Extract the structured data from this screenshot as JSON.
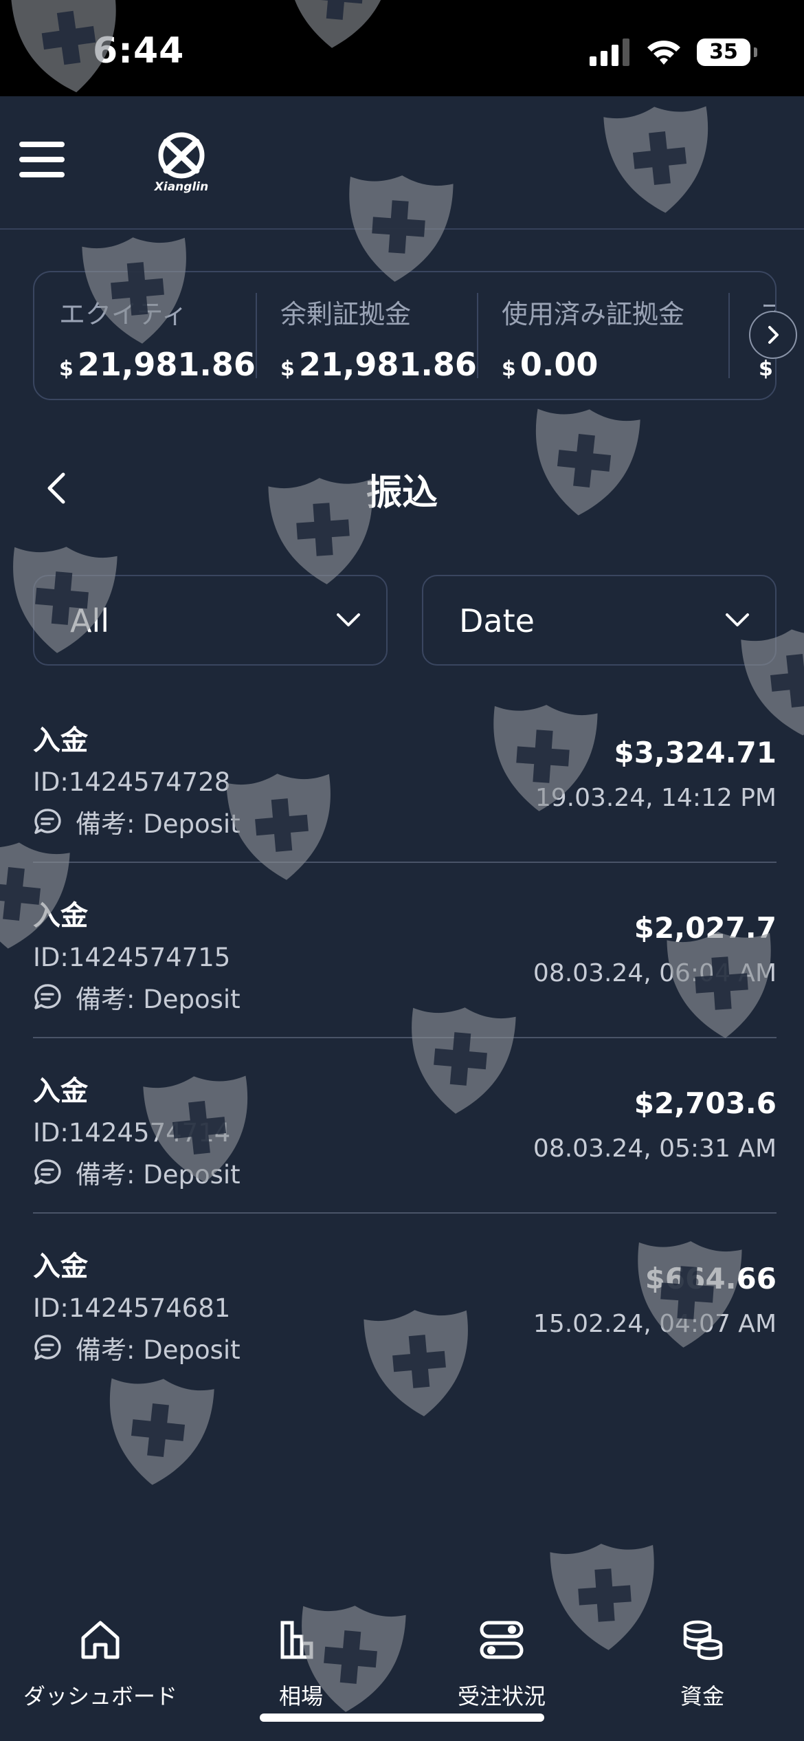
{
  "status_bar": {
    "time": "6:44",
    "battery": "35"
  },
  "header": {
    "logo_text": "Xianglin"
  },
  "account": {
    "metrics": [
      {
        "label": "エクイティ",
        "currency": "$",
        "value": "21,981.86"
      },
      {
        "label": "余剰証拠金",
        "currency": "$",
        "value": "21,981.86"
      },
      {
        "label": "使用済み証拠金",
        "currency": "$",
        "value": "0.00"
      },
      {
        "label": "ス",
        "currency": "$",
        "value": ""
      }
    ]
  },
  "page": {
    "title": "振込"
  },
  "filters": {
    "type_value": "All",
    "date_value": "Date"
  },
  "transactions": [
    {
      "type": "入金",
      "id": "ID:1424574728",
      "note": "備考: Deposit",
      "amount": "$3,324.71",
      "date": "19.03.24, 14:12 PM"
    },
    {
      "type": "入金",
      "id": "ID:1424574715",
      "note": "備考: Deposit",
      "amount": "$2,027.7",
      "date": "08.03.24, 06:04 AM"
    },
    {
      "type": "入金",
      "id": "ID:1424574714",
      "note": "備考: Deposit",
      "amount": "$2,703.6",
      "date": "08.03.24, 05:31 AM"
    },
    {
      "type": "入金",
      "id": "ID:1424574681",
      "note": "備考: Deposit",
      "amount": "$664.66",
      "date": "15.02.24, 04:07 AM"
    }
  ],
  "tabs": [
    {
      "label": "ダッシュボード",
      "icon": "home-icon"
    },
    {
      "label": "相場",
      "icon": "bar-chart-icon"
    },
    {
      "label": "受注状況",
      "icon": "toggles-icon"
    },
    {
      "label": "資金",
      "icon": "coins-icon"
    }
  ],
  "colors": {
    "background": "#1d2738",
    "border": "#3a4660",
    "text_secondary": "#c7ccd6",
    "label": "#9aa3b5"
  }
}
